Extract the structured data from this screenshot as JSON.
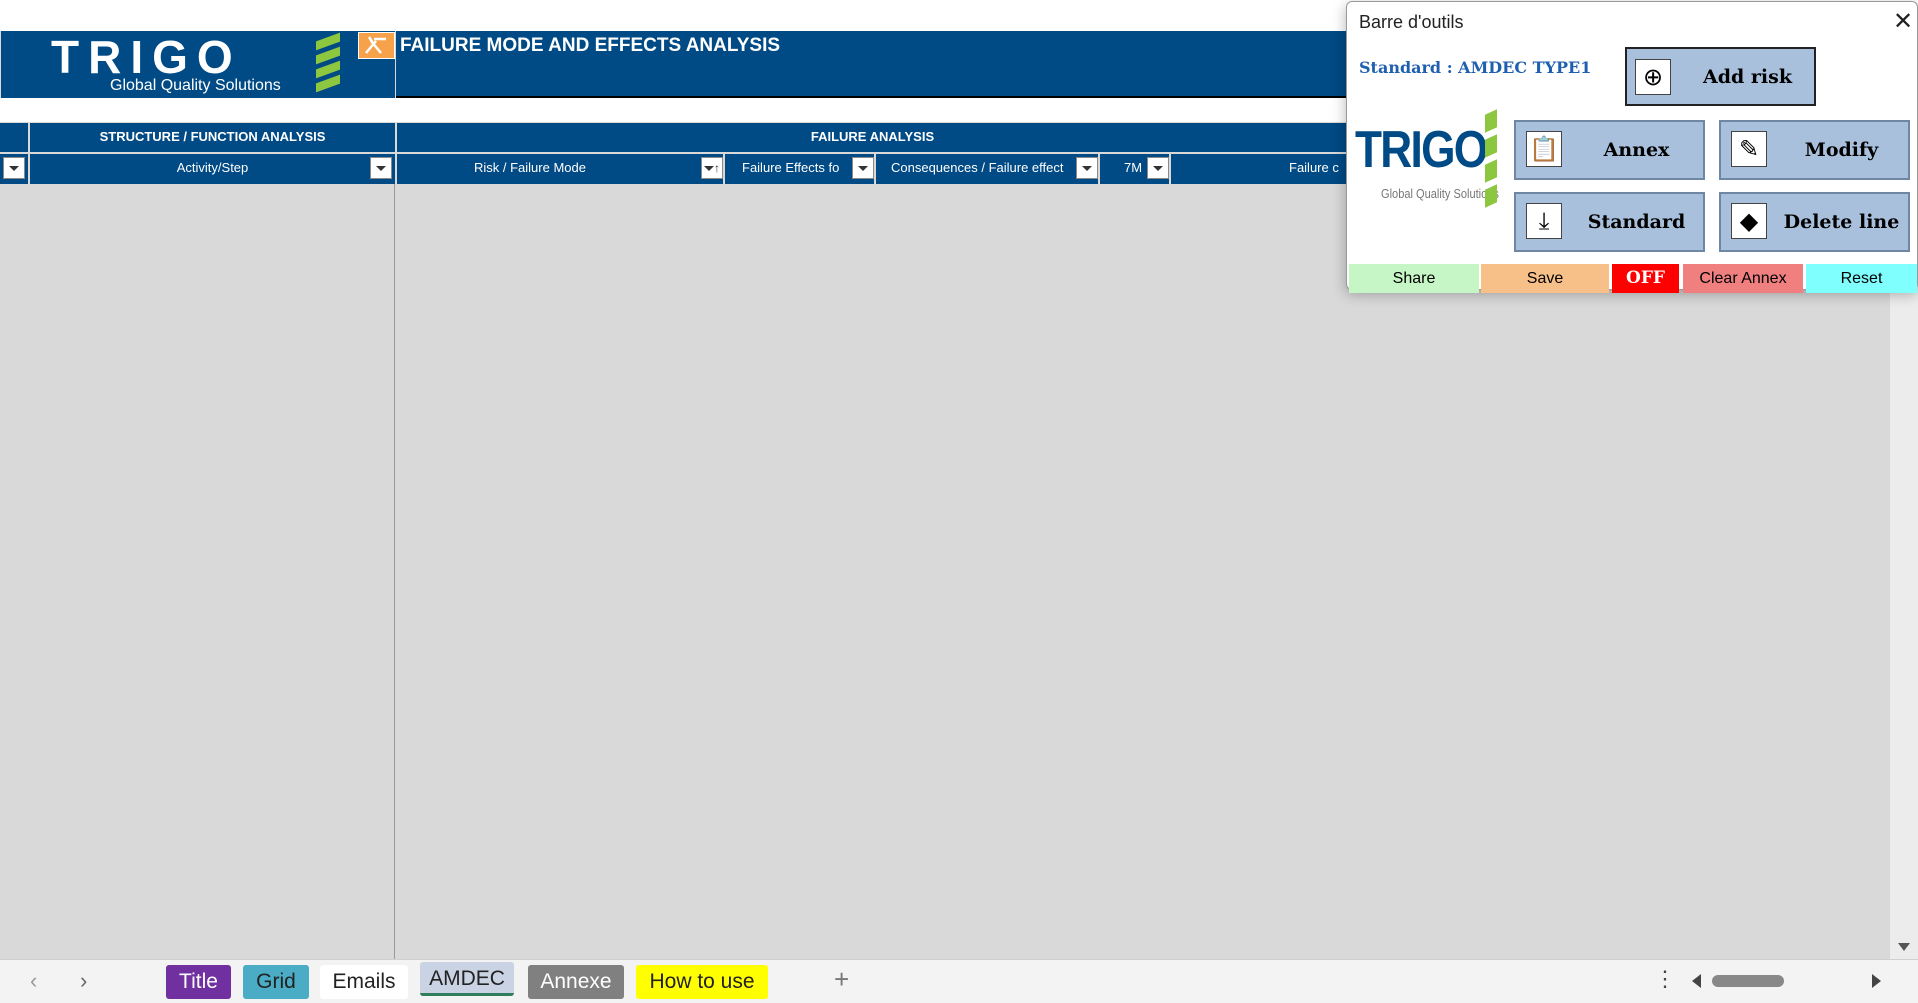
{
  "header": {
    "logo_text": "TRIGO",
    "logo_tagline": "Global Quality Solutions",
    "title": "FAILURE MODE AND EFFECTS ANALYSIS",
    "menu_icon": "tools-icon"
  },
  "sections": {
    "structure": "STRUCTURE / FUNCTION ANALYSIS",
    "failure": "FAILURE ANALYSIS"
  },
  "columns": {
    "activity": "Activity/Step",
    "risk": "Risk / Failure Mode",
    "effects": "Failure Effects fo",
    "consequences": "Consequences / Failure effect",
    "seven_m": "7M",
    "failure_c": "Failure c"
  },
  "toolbar": {
    "title": "Barre d'outils",
    "standard_label": "Standard : AMDEC TYPE1",
    "logo_text": "TRIGO",
    "logo_tagline": "Global Quality Solutions",
    "buttons": {
      "add_risk": "Add risk",
      "annex": "Annex",
      "modify": "Modify",
      "standard": "Standard",
      "delete_line": "Delete line"
    },
    "bottom": {
      "share": "Share",
      "save": "Save",
      "off": "OFF",
      "clear_annex": "Clear Annex",
      "reset": "Reset"
    },
    "colors": {
      "share": "#c6f5c6",
      "save": "#f8c089",
      "off": "#ff0000",
      "clear_annex": "#f08080",
      "reset": "#80ffff",
      "button": "#a8c0dc"
    }
  },
  "sheet_tabs": [
    {
      "label": "Title",
      "color": "#7030a0"
    },
    {
      "label": "Grid",
      "color": "#4bacc6"
    },
    {
      "label": "Emails",
      "color": "#ffffff"
    },
    {
      "label": "AMDEC",
      "color": "#c9d3e4"
    },
    {
      "label": "Annexe",
      "color": "#808080"
    },
    {
      "label": "How to use",
      "color": "#ffff00"
    }
  ]
}
